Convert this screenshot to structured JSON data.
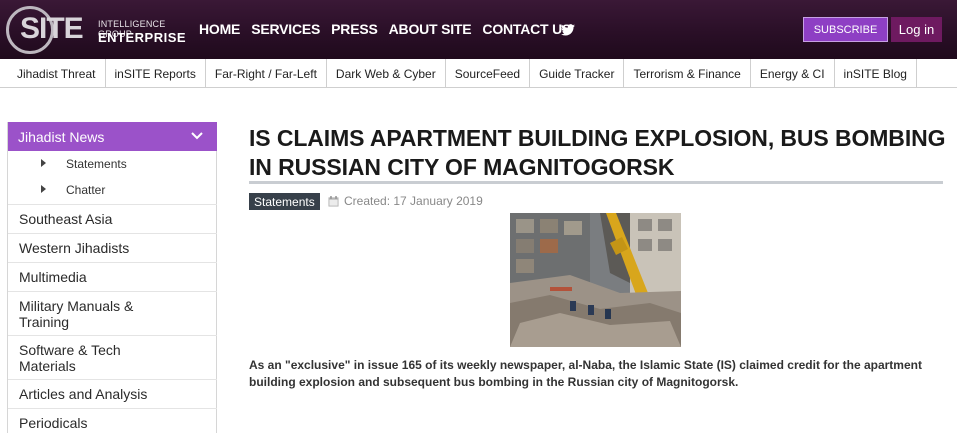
{
  "header": {
    "logo_word": "SITE",
    "logo_line1": "INTELLIGENCE GROUP",
    "logo_line2": "ENTERPRISE",
    "nav": [
      "HOME",
      "SERVICES",
      "PRESS",
      "ABOUT SITE",
      "CONTACT US"
    ],
    "subscribe_label": "SUBSCRIBE",
    "login_label": "Log in"
  },
  "subnav": [
    "Jihadist Threat",
    "inSITE Reports",
    "Far-Right / Far-Left",
    "Dark Web & Cyber",
    "SourceFeed",
    "Guide Tracker",
    "Terrorism & Finance",
    "Energy & CI",
    "inSITE Blog"
  ],
  "sidebar": {
    "heading": "Jihadist News",
    "subitems": [
      "Statements",
      "Chatter"
    ],
    "items": [
      "Southeast Asia",
      "Western Jihadists",
      "Multimedia",
      "Military Manuals & Training",
      "Software & Tech Materials",
      "Articles and Analysis",
      "Periodicals"
    ]
  },
  "article": {
    "title": "IS CLAIMS APARTMENT BUILDING EXPLOSION, BUS BOMBING IN RUSSIAN CITY OF MAGNITOGORSK",
    "category": "Statements",
    "created": "Created: 17 January 2019",
    "lede": "As an \"exclusive\" in issue 165 of its weekly newspaper, al-Naba, the Islamic State (IS) claimed credit for the apartment building explosion and subsequent bus bombing in the Russian city of Magnitogorsk."
  },
  "colors": {
    "header_bg": "#2a0f27",
    "sidebar_active": "#9b52c9",
    "subscribe": "#8e3fc4",
    "login": "#6e1a60",
    "tag_bg": "#37404a"
  }
}
